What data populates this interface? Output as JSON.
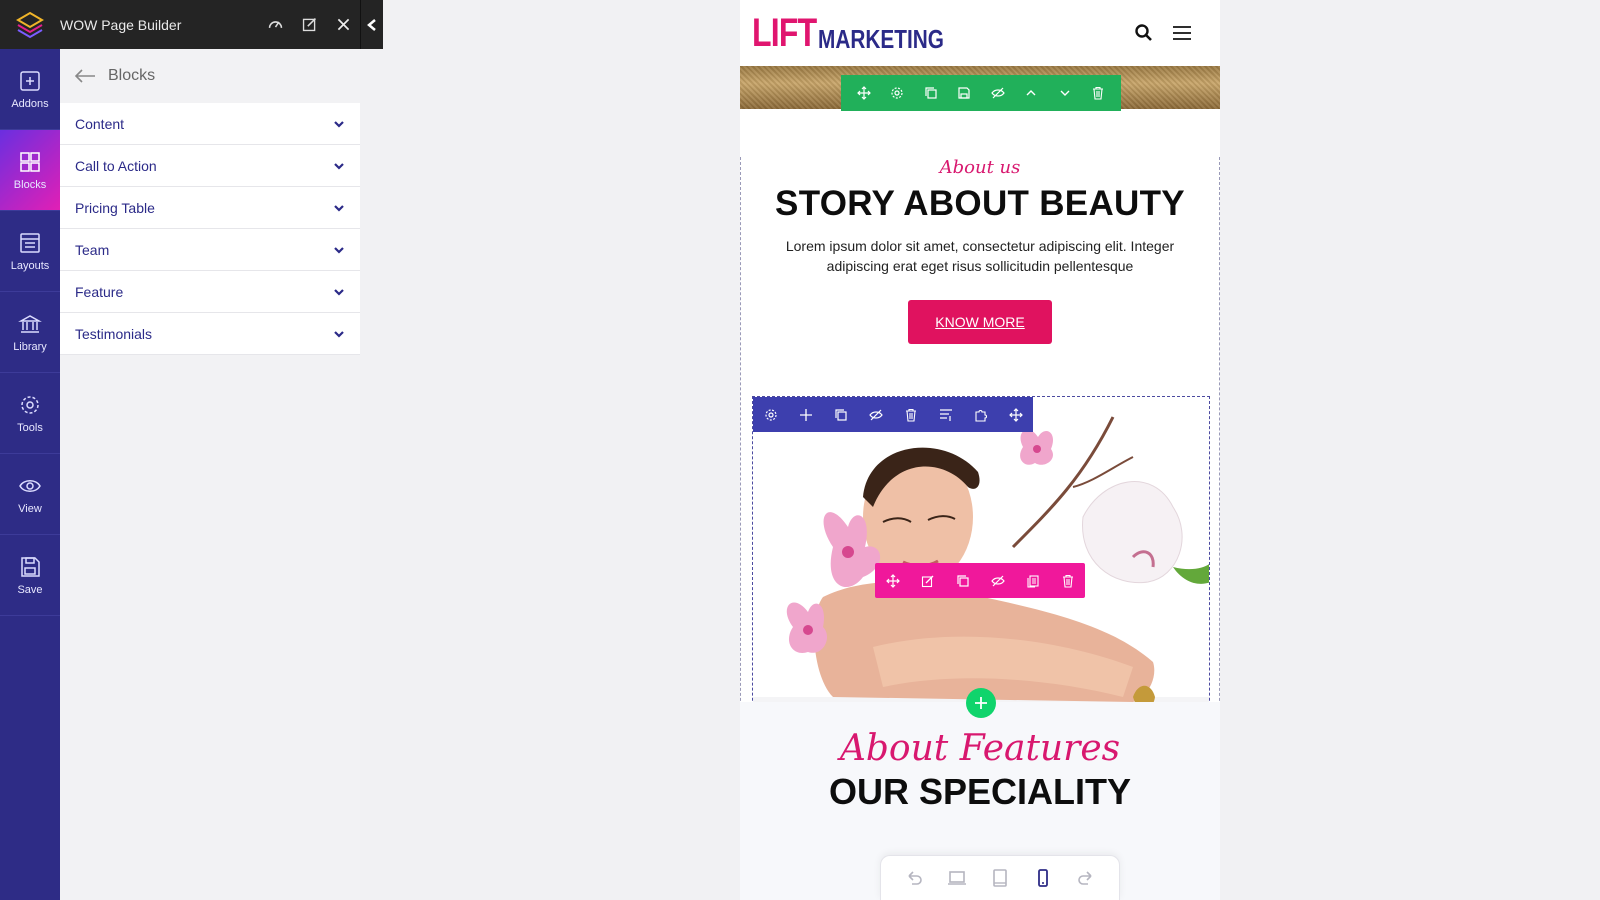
{
  "app": {
    "title": "WOW Page Builder"
  },
  "rail": {
    "items": [
      {
        "label": "Addons",
        "icon": "plus-square-icon"
      },
      {
        "label": "Blocks",
        "icon": "blocks-icon"
      },
      {
        "label": "Layouts",
        "icon": "layouts-icon"
      },
      {
        "label": "Library",
        "icon": "library-icon"
      },
      {
        "label": "Tools",
        "icon": "gear-icon"
      },
      {
        "label": "View",
        "icon": "eye-icon"
      },
      {
        "label": "Save",
        "icon": "floppy-icon"
      }
    ],
    "active": "Blocks"
  },
  "panel": {
    "title": "Blocks",
    "categories": [
      {
        "label": "Content"
      },
      {
        "label": "Call to Action"
      },
      {
        "label": "Pricing Table"
      },
      {
        "label": "Team"
      },
      {
        "label": "Feature"
      },
      {
        "label": "Testimonials"
      }
    ]
  },
  "site": {
    "brand_part1": "LIFT",
    "brand_part2": "MARKETING",
    "about": {
      "subtitle": "About us",
      "title": "STORY ABOUT BEAUTY",
      "text": "Lorem ipsum dolor sit amet, consectetur adipiscing elit. Integer adipiscing erat eget risus sollicitudin pellentesque",
      "button": "KNOW MORE"
    },
    "features": {
      "subtitle": "About Features",
      "title": "OUR SPECIALITY"
    }
  },
  "colors": {
    "rail": "#2e2c86",
    "accent_pink": "#e0125f",
    "section_toolbar": "#21b05a",
    "row_toolbar": "#3d3fae",
    "column_toolbar": "#f0189b",
    "add_button": "#10d46c"
  }
}
